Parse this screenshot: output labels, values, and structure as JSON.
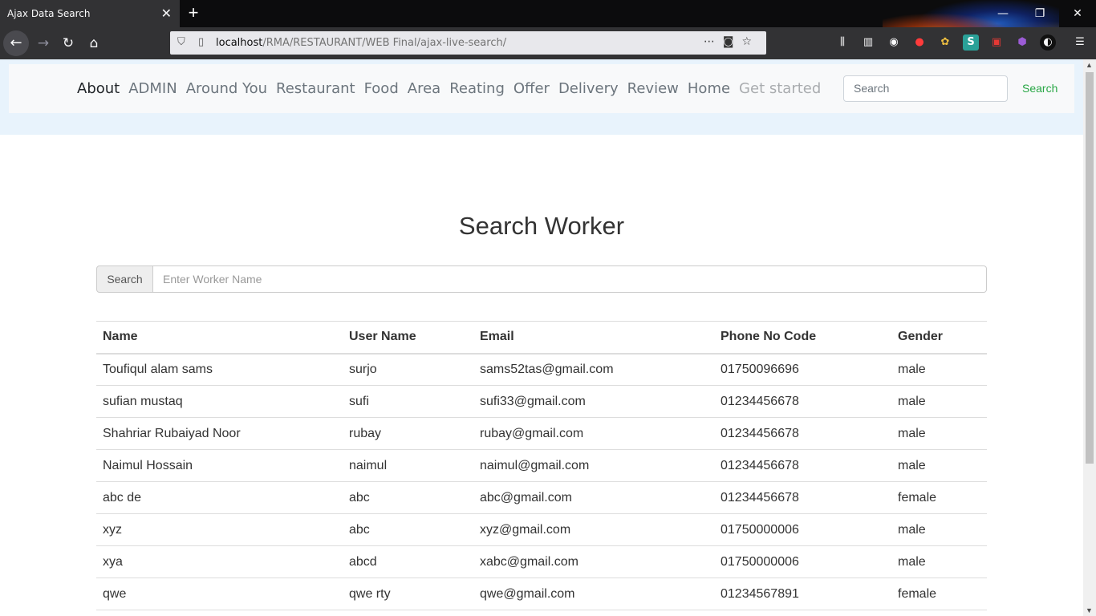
{
  "browser": {
    "tab_title": "Ajax Data Search",
    "url_host": "localhost",
    "url_path": "/RMA/RESTAURANT/WEB Final/ajax-live-search/"
  },
  "site_nav": {
    "links": [
      {
        "label": "About",
        "state": "active"
      },
      {
        "label": "ADMIN",
        "state": "normal"
      },
      {
        "label": "Around You",
        "state": "normal"
      },
      {
        "label": "Restaurant",
        "state": "normal"
      },
      {
        "label": "Food",
        "state": "normal"
      },
      {
        "label": "Area",
        "state": "normal"
      },
      {
        "label": "Reating",
        "state": "normal"
      },
      {
        "label": "Offer",
        "state": "normal"
      },
      {
        "label": "Delivery",
        "state": "normal"
      },
      {
        "label": "Review",
        "state": "normal"
      },
      {
        "label": "Home",
        "state": "normal"
      },
      {
        "label": "Get started",
        "state": "disabled"
      }
    ],
    "search_placeholder": "Search",
    "search_button": "Search"
  },
  "main": {
    "title": "Search Worker",
    "search_addon": "Search",
    "search_placeholder": "Enter Worker Name",
    "table": {
      "headers": [
        "Name",
        "User Name",
        "Email",
        "Phone No Code",
        "Gender"
      ],
      "rows": [
        [
          "Toufiqul alam sams",
          "surjo",
          "sams52tas@gmail.com",
          "01750096696",
          "male"
        ],
        [
          "sufian mustaq",
          "sufi",
          "sufi33@gmail.com",
          "01234456678",
          "male"
        ],
        [
          "Shahriar Rubaiyad Noor",
          "rubay",
          "rubay@gmail.com",
          "01234456678",
          "male"
        ],
        [
          "Naimul Hossain",
          "naimul",
          "naimul@gmail.com",
          "01234456678",
          "male"
        ],
        [
          "abc de",
          "abc",
          "abc@gmail.com",
          "01234456678",
          "female"
        ],
        [
          "xyz",
          "abc",
          "xyz@gmail.com",
          "01750000006",
          "male"
        ],
        [
          "xya",
          "abcd",
          "xabc@gmail.com",
          "01750000006",
          "male"
        ],
        [
          "qwe",
          "qwe rty",
          "qwe@gmail.com",
          "01234567891",
          "female"
        ]
      ]
    }
  }
}
